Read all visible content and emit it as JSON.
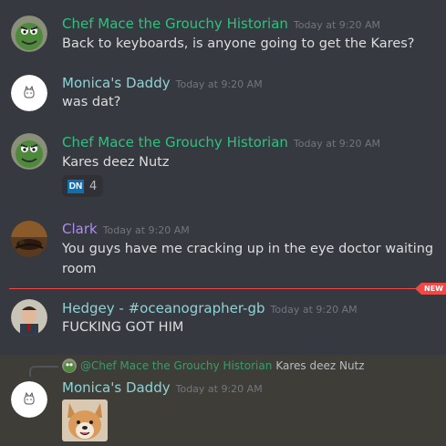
{
  "colors": {
    "background": "#36393f",
    "chef_name": "#2ec27e",
    "monica_name": "#8fd3d6",
    "clark_name": "#b08cf0",
    "hedgey_name": "#8fd3d6",
    "new_divider": "#f04747",
    "highlight": "#3f3d38"
  },
  "messages": [
    {
      "username": "Chef Mace the Grouchy Historian",
      "timestamp": "Today at 9:20 AM",
      "text": "Back to keyboards, is anyone going to get the Kares?",
      "avatar": "oscar-avatar"
    },
    {
      "username": "Monica's Daddy",
      "timestamp": "Today at 9:20 AM",
      "text": "was dat?",
      "avatar": "cat-sketch-avatar"
    },
    {
      "username": "Chef Mace the Grouchy Historian",
      "timestamp": "Today at 9:20 AM",
      "text": "Kares deez Nutz",
      "avatar": "oscar-avatar",
      "reaction": {
        "emoji": "DN",
        "count": "4"
      }
    },
    {
      "username": "Clark",
      "timestamp": "Today at 9:20 AM",
      "text_line1": "You guys have me cracking up in the eye doctor waiting",
      "text_line2": "room",
      "avatar": "photo-avatar"
    },
    {
      "username": "Hedgey - #oceanographer-gb",
      "timestamp": "Today at 9:20 AM",
      "text": "FUCKING GOT HIM",
      "avatar": "person-avatar"
    },
    {
      "reply_to_user": "@Chef Mace the Grouchy Historian",
      "reply_to_text": "Kares deez Nutz",
      "username": "Monica's Daddy",
      "timestamp": "Today at 9:20 AM",
      "attachment": "corgi-image",
      "avatar": "cat-sketch-avatar"
    }
  ],
  "divider": {
    "label": "NEW"
  }
}
